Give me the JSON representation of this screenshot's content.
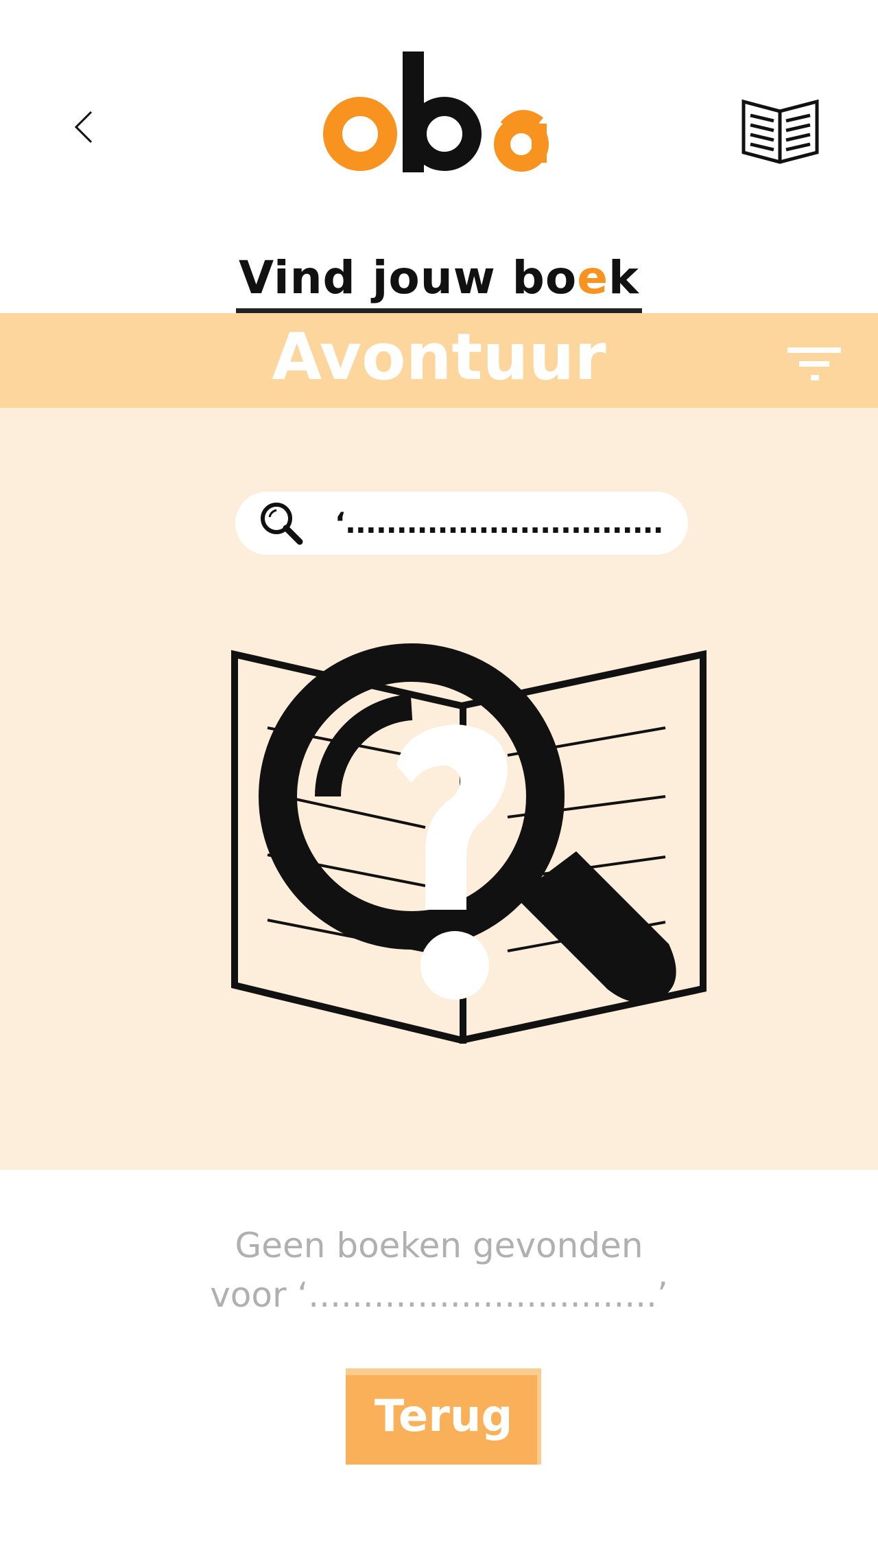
{
  "header": {
    "back_icon": "chevron-left-icon",
    "logo_text": "oba",
    "reader_icon": "open-book-icon"
  },
  "page": {
    "title_before": "Vind jouw bo",
    "title_accent": "e",
    "title_after": "k"
  },
  "category": {
    "label": "Avontuur",
    "filter_icon": "filter-icon"
  },
  "search": {
    "icon": "search-icon",
    "query": "‘.................................’"
  },
  "illustration": {
    "icon": "book-magnifier-question-icon"
  },
  "result": {
    "line1": "Geen boeken gevonden",
    "line2": "voor ‘................................’"
  },
  "actions": {
    "back_label": "Terug"
  },
  "colors": {
    "accent": "#f7931e",
    "category_bar": "#fdd69e",
    "content_bg": "#fdeedb",
    "button": "#f9b058",
    "muted_text": "#b0b0b0"
  }
}
